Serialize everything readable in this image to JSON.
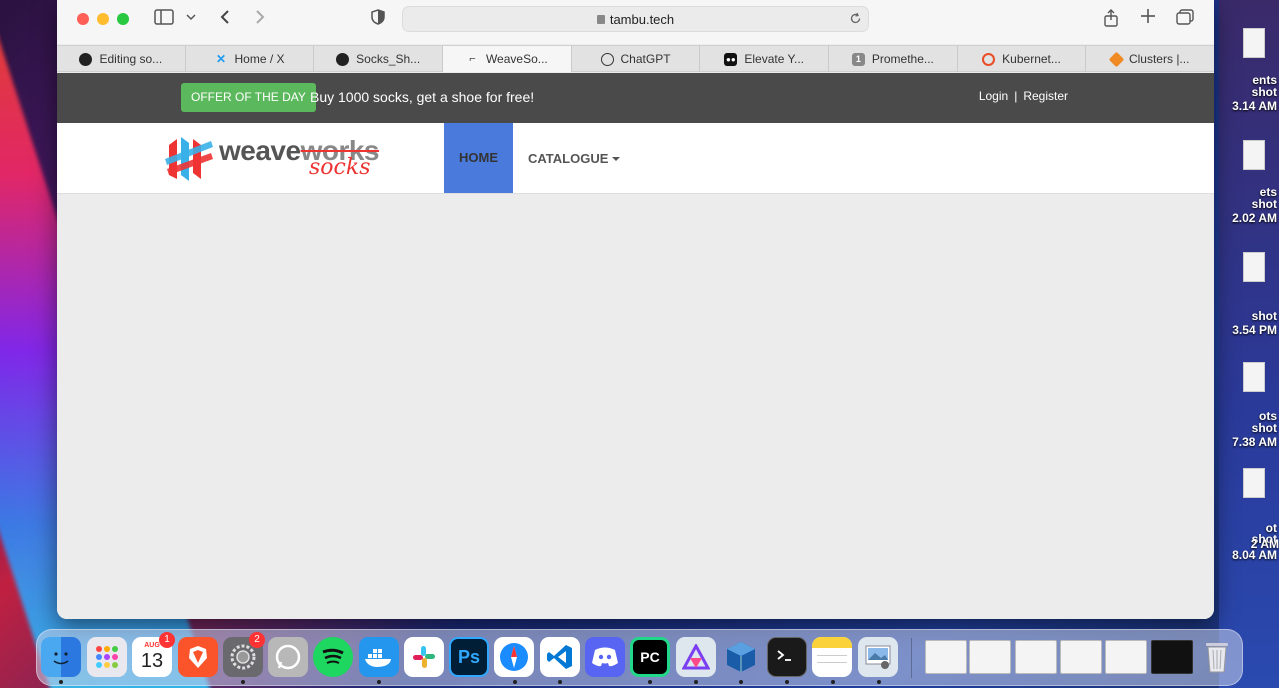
{
  "browser": {
    "url": "tambu.tech",
    "tabs": [
      {
        "label": "Editing so...",
        "icon": "github-icon"
      },
      {
        "label": "Home / X",
        "icon": "x-icon"
      },
      {
        "label": "Socks_Sh...",
        "icon": "github-icon"
      },
      {
        "label": "WeaveSo...",
        "icon": "sock-icon",
        "active": true
      },
      {
        "label": "ChatGPT",
        "icon": "chatgpt-icon"
      },
      {
        "label": "Elevate Y...",
        "icon": "medium-icon"
      },
      {
        "label": "Promethe...",
        "icon": "number-badge-icon",
        "badge": "1"
      },
      {
        "label": "Kubernet...",
        "icon": "grafana-icon"
      },
      {
        "label": "Clusters |...",
        "icon": "cube-icon"
      }
    ]
  },
  "page": {
    "offer_badge": "OFFER OF THE DAY",
    "offer_text": "Buy 1000 socks, get a shoe for free!",
    "login": "Login",
    "separator": "|",
    "register": "Register",
    "logo_weave": "weave",
    "logo_works": "works",
    "logo_socks": "socks",
    "nav_home": "HOME",
    "nav_catalogue": "CATALOGUE"
  },
  "desktop": {
    "labels": [
      "ents",
      "shot",
      "3.14 AM",
      "ets",
      "shot",
      "2.02 AM",
      "shot",
      "3.54 PM",
      "ots",
      "shot",
      "7.38 AM",
      "ot",
      "shot",
      "2 AM",
      "8.04 AM"
    ]
  },
  "dock": {
    "calendar_month": "AUG",
    "calendar_day": "13",
    "calendar_badge": "1",
    "settings_badge": "2",
    "photoshop_label": "Ps",
    "pycharm_label": "PC"
  },
  "colors": {
    "offer_green": "#5cb85c",
    "home_blue": "#4a7bdc",
    "logo_red": "#e33333"
  }
}
